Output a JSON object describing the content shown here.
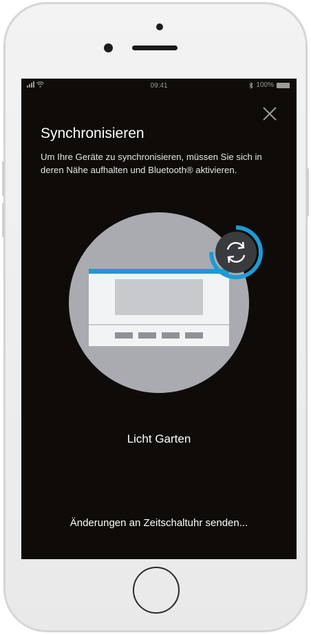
{
  "statusbar": {
    "time": "09:41",
    "battery_text": "100%"
  },
  "dialog": {
    "title": "Synchronisieren",
    "description": "Um Ihre Geräte zu synchronisieren, müssen Sie sich in deren Nähe aufhalten und Bluetooth® aktivieren.",
    "device_name": "Licht Garten",
    "status_message": "Änderungen an Zeitschaltuhr senden..."
  },
  "colors": {
    "screen_background": "#0e0b08",
    "accent": "#1e9ad6",
    "circle": "#a9abb0",
    "device_panel": "#f2f3f4",
    "device_display": "#c7c9cd",
    "device_buttons": "#8e9197",
    "sync_badge": "#3a3b3e"
  },
  "icons": {
    "close": "close-icon",
    "sync": "sync-icon",
    "bluetooth": "bluetooth-icon",
    "wifi": "wifi-icon",
    "signal": "signal-icon",
    "battery": "battery-icon"
  }
}
